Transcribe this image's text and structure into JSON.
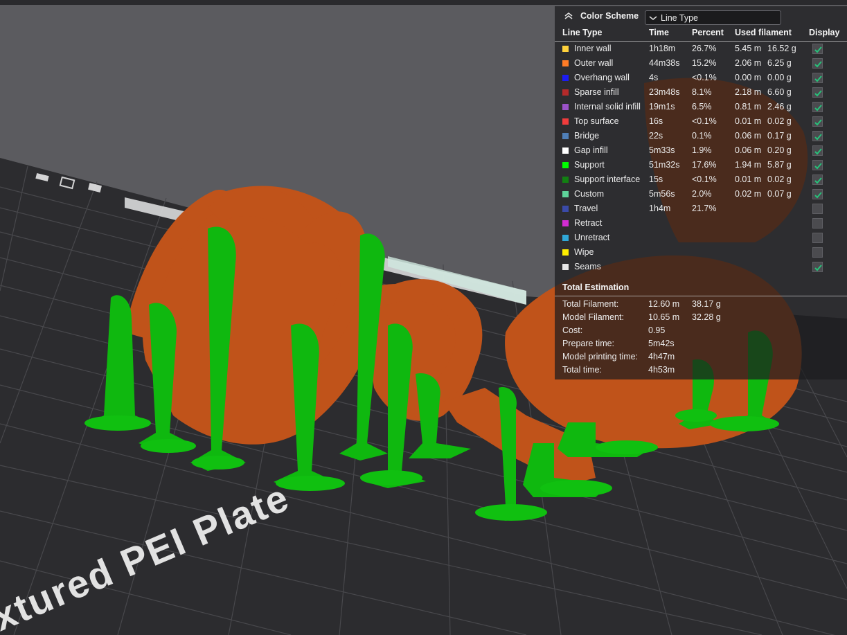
{
  "legend": {
    "color_scheme_label": "Color Scheme",
    "selected_scheme": "Line Type",
    "headers": {
      "line_type": "Line Type",
      "time": "Time",
      "percent": "Percent",
      "used_filament": "Used filament",
      "display": "Display"
    },
    "rows": [
      {
        "name": "Inner wall",
        "time": "1h18m",
        "percent": "26.7%",
        "length": "5.45 m",
        "weight": "16.52 g",
        "color": "#ffd23c",
        "checked": true
      },
      {
        "name": "Outer wall",
        "time": "44m38s",
        "percent": "15.2%",
        "length": "2.06 m",
        "weight": "6.25 g",
        "color": "#ff7c26",
        "checked": true
      },
      {
        "name": "Overhang wall",
        "time": "4s",
        "percent": "<0.1%",
        "length": "0.00 m",
        "weight": "0.00 g",
        "color": "#1c1cf2",
        "checked": true
      },
      {
        "name": "Sparse infill",
        "time": "23m48s",
        "percent": "8.1%",
        "length": "2.18 m",
        "weight": "6.60 g",
        "color": "#b52a2a",
        "checked": true
      },
      {
        "name": "Internal solid infill",
        "time": "19m1s",
        "percent": "6.5%",
        "length": "0.81 m",
        "weight": "2.46 g",
        "color": "#9a52c8",
        "checked": true
      },
      {
        "name": "Top surface",
        "time": "16s",
        "percent": "<0.1%",
        "length": "0.01 m",
        "weight": "0.02 g",
        "color": "#f03c3c",
        "checked": true
      },
      {
        "name": "Bridge",
        "time": "22s",
        "percent": "0.1%",
        "length": "0.06 m",
        "weight": "0.17 g",
        "color": "#4f7fb8",
        "checked": true
      },
      {
        "name": "Gap infill",
        "time": "5m33s",
        "percent": "1.9%",
        "length": "0.06 m",
        "weight": "0.20 g",
        "color": "#ffffff",
        "checked": true
      },
      {
        "name": "Support",
        "time": "51m32s",
        "percent": "17.6%",
        "length": "1.94 m",
        "weight": "5.87 g",
        "color": "#00ff00",
        "checked": true
      },
      {
        "name": "Support interface",
        "time": "15s",
        "percent": "<0.1%",
        "length": "0.01 m",
        "weight": "0.02 g",
        "color": "#128012",
        "checked": true
      },
      {
        "name": "Custom",
        "time": "5m56s",
        "percent": "2.0%",
        "length": "0.02 m",
        "weight": "0.07 g",
        "color": "#5ed39a",
        "checked": true
      },
      {
        "name": "Travel",
        "time": "1h4m",
        "percent": "21.7%",
        "length": "",
        "weight": "",
        "color": "#3a4aa8",
        "checked": false
      },
      {
        "name": "Retract",
        "time": "",
        "percent": "",
        "length": "",
        "weight": "",
        "color": "#d22cd2",
        "checked": false
      },
      {
        "name": "Unretract",
        "time": "",
        "percent": "",
        "length": "",
        "weight": "",
        "color": "#30a8d8",
        "checked": false
      },
      {
        "name": "Wipe",
        "time": "",
        "percent": "",
        "length": "",
        "weight": "",
        "color": "#ffee00",
        "checked": false
      },
      {
        "name": "Seams",
        "time": "",
        "percent": "",
        "length": "",
        "weight": "",
        "color": "#e6e6e6",
        "checked": true
      }
    ],
    "total_estimation": {
      "title": "Total Estimation",
      "rows": [
        {
          "label": "Total Filament:",
          "value1": "12.60 m",
          "value2": "38.17 g"
        },
        {
          "label": "Model Filament:",
          "value1": "10.65 m",
          "value2": "32.28 g"
        },
        {
          "label": "Cost:",
          "value1": "0.95",
          "value2": ""
        },
        {
          "label": "Prepare time:",
          "value1": "5m42s",
          "value2": ""
        },
        {
          "label": "Model printing time:",
          "value1": "4h47m",
          "value2": ""
        },
        {
          "label": "Total time:",
          "value1": "4h53m",
          "value2": ""
        }
      ]
    }
  },
  "plate": {
    "label": "xtured PEI Plate"
  },
  "colors": {
    "model": "#c0531a",
    "support": "#0fb80f",
    "bed": "#2c2c2f",
    "grid": "#4a4a4e",
    "checkmark": "#27c27a"
  }
}
